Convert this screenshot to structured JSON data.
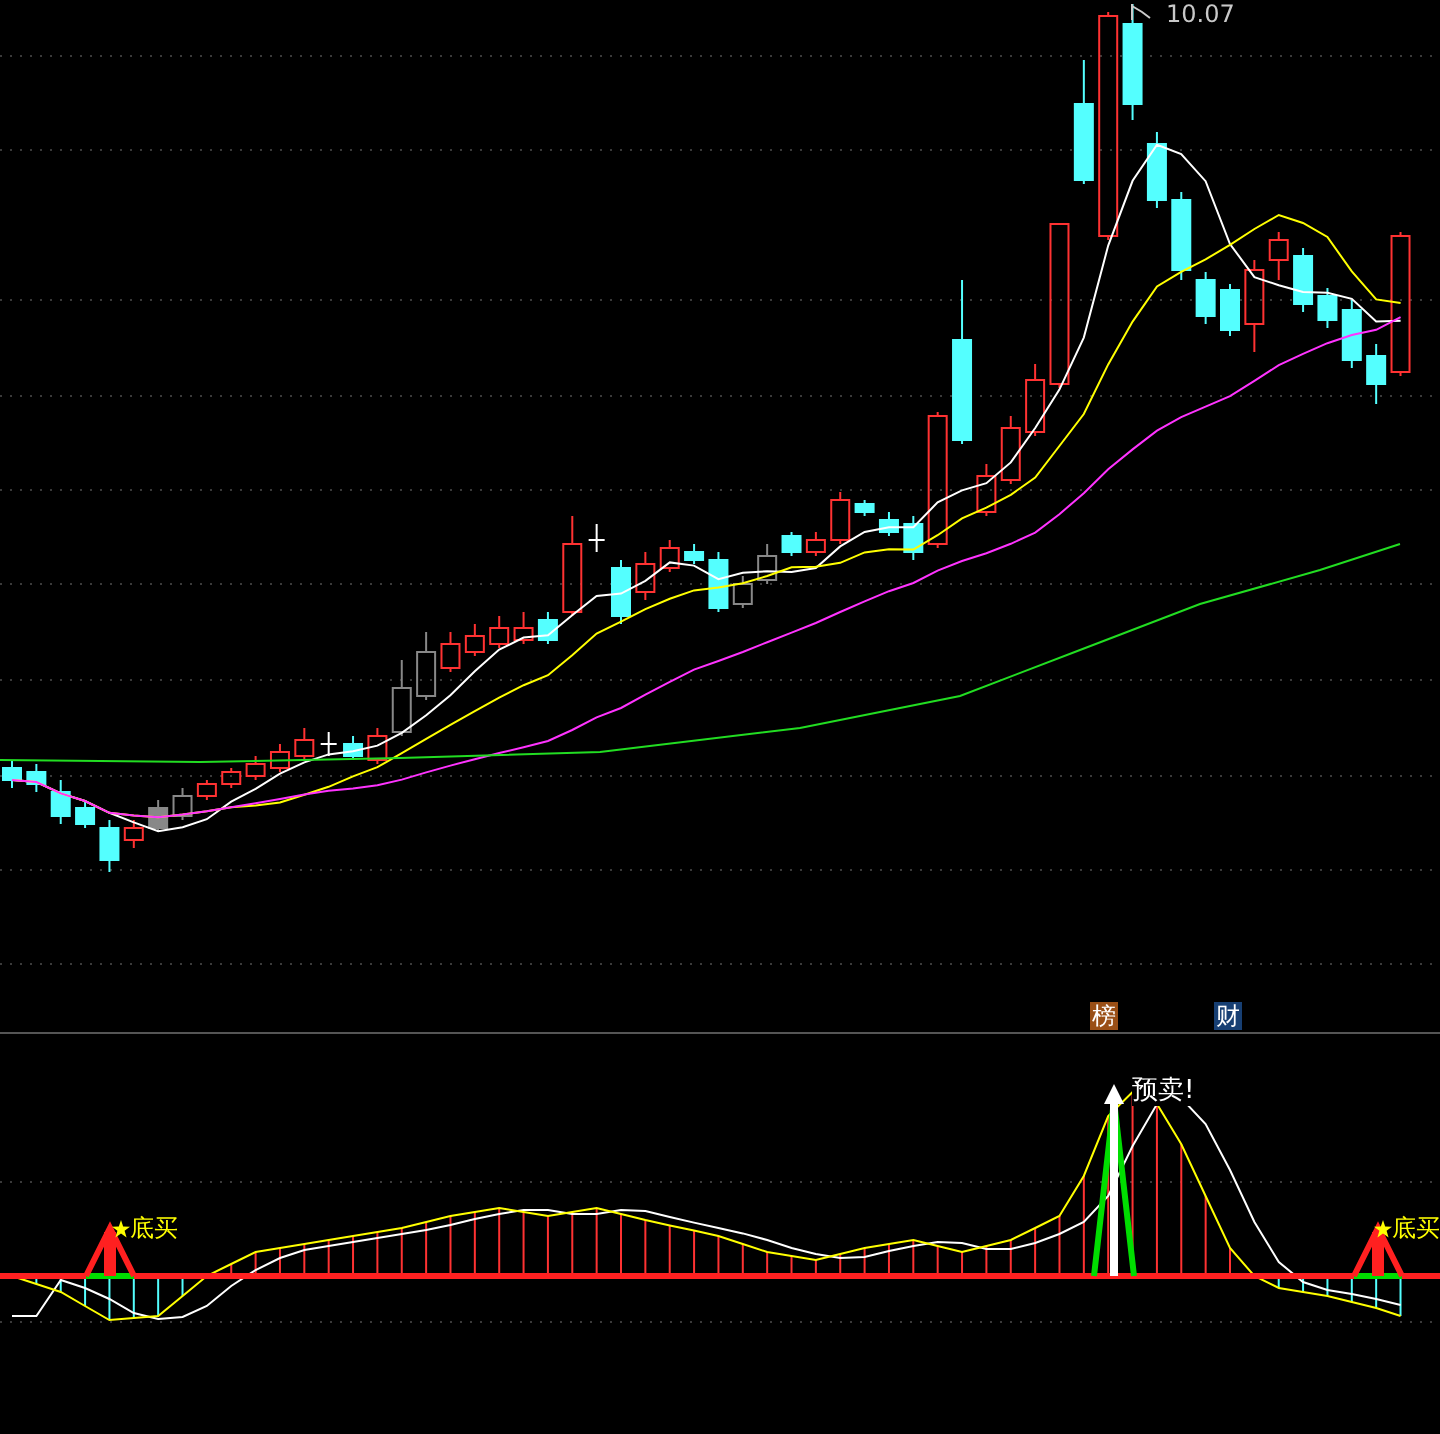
{
  "chart": {
    "high_label": "10.07"
  },
  "badges": [
    {
      "text": "榜",
      "color": "#9a4f16"
    },
    {
      "text": "财",
      "color": "#173f73"
    }
  ],
  "indicator": {
    "signals": [
      {
        "kind": "buy",
        "label": "底买"
      },
      {
        "kind": "sell",
        "label": "预卖!"
      },
      {
        "kind": "buy",
        "label": "底买"
      }
    ]
  }
}
